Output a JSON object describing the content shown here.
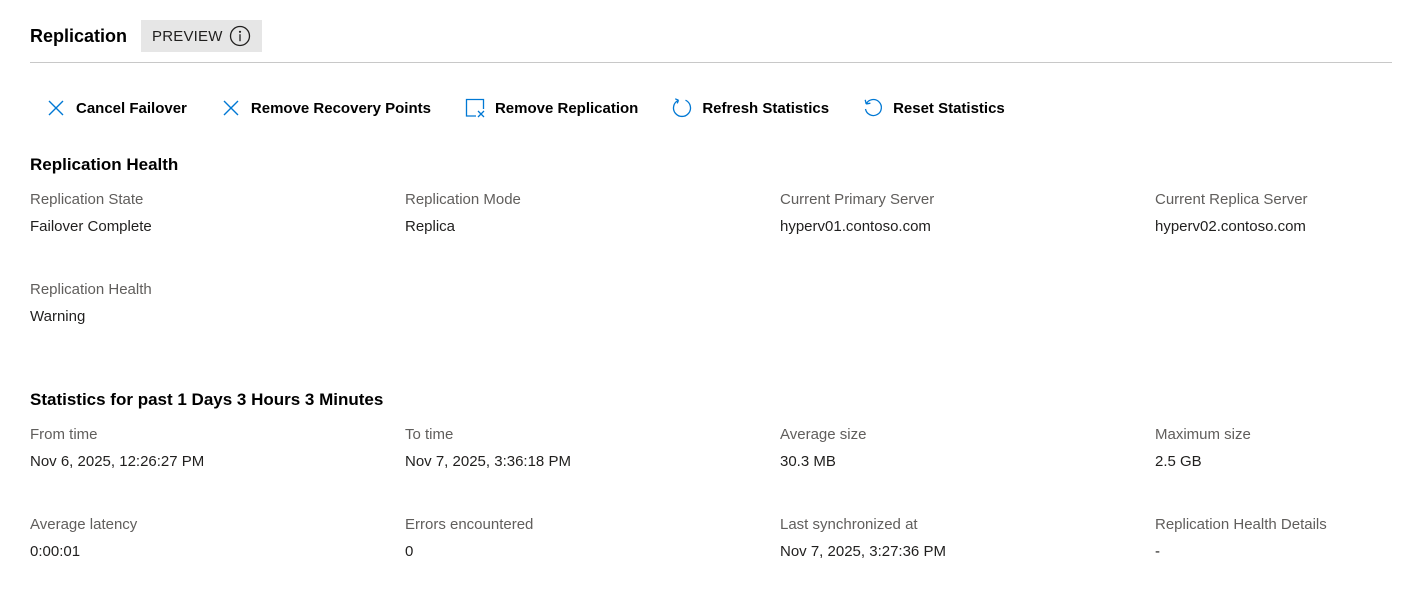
{
  "header": {
    "title": "Replication",
    "badge_label": "PREVIEW",
    "badge_icon": "info-icon"
  },
  "toolbar": {
    "buttons": [
      {
        "label": "Cancel Failover",
        "icon": "close-icon"
      },
      {
        "label": "Remove Recovery Points",
        "icon": "close-icon"
      },
      {
        "label": "Remove Replication",
        "icon": "remove-box-icon"
      },
      {
        "label": "Refresh Statistics",
        "icon": "refresh-icon"
      },
      {
        "label": "Reset Statistics",
        "icon": "reset-icon"
      }
    ]
  },
  "health": {
    "title": "Replication Health",
    "fields": [
      {
        "label": "Replication State",
        "value": "Failover Complete"
      },
      {
        "label": "Replication Mode",
        "value": "Replica"
      },
      {
        "label": "Current Primary Server",
        "value": "hyperv01.contoso.com"
      },
      {
        "label": "Current Replica Server",
        "value": "hyperv02.contoso.com"
      },
      {
        "label": "Replication Health",
        "value": "Warning"
      }
    ]
  },
  "stats": {
    "title": "Statistics for past 1 Days 3 Hours 3 Minutes",
    "fields": [
      {
        "label": "From time",
        "value": "Nov 6, 2025, 12:26:27 PM"
      },
      {
        "label": "To time",
        "value": "Nov 7, 2025, 3:36:18 PM"
      },
      {
        "label": "Average size",
        "value": "30.3 MB"
      },
      {
        "label": "Maximum size",
        "value": "2.5 GB"
      },
      {
        "label": "Average latency",
        "value": "0:00:01"
      },
      {
        "label": "Errors encountered",
        "value": "0"
      },
      {
        "label": "Last synchronized at",
        "value": "Nov 7, 2025, 3:27:36 PM"
      },
      {
        "label": "Replication Health Details",
        "value": "-"
      }
    ]
  },
  "colors": {
    "accent": "#0078d4",
    "badge_bg": "#e6e6e6",
    "label_text": "#605e5c"
  }
}
